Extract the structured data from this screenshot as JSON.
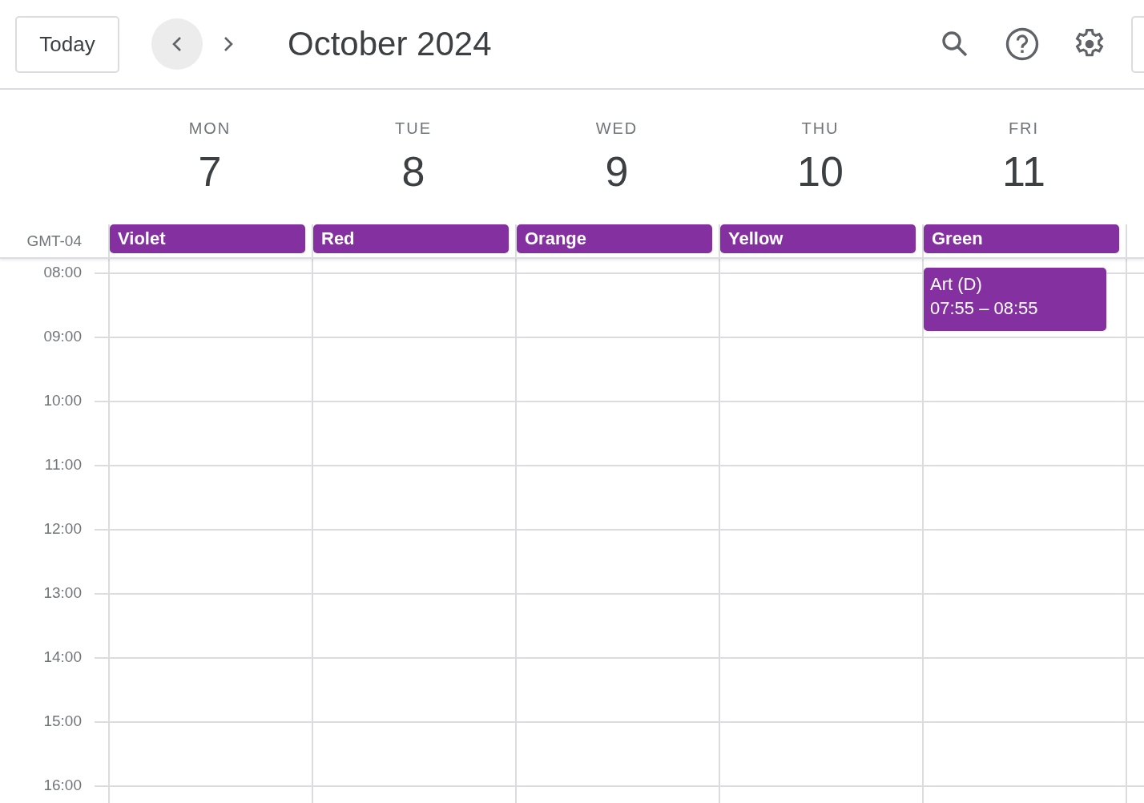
{
  "toolbar": {
    "today_button": "Today",
    "title": "October 2024"
  },
  "timezone": "GMT-04",
  "days": [
    {
      "weekday": "MON",
      "date": "7",
      "all_day": "Violet"
    },
    {
      "weekday": "TUE",
      "date": "8",
      "all_day": "Red"
    },
    {
      "weekday": "WED",
      "date": "9",
      "all_day": "Orange"
    },
    {
      "weekday": "THU",
      "date": "10",
      "all_day": "Yellow"
    },
    {
      "weekday": "FRI",
      "date": "11",
      "all_day": "Green",
      "events": [
        {
          "title": "Art (D)",
          "time": "07:55 – 08:55"
        }
      ]
    }
  ],
  "hours": [
    "08:00",
    "09:00",
    "10:00",
    "11:00",
    "12:00",
    "13:00",
    "14:00",
    "15:00",
    "16:00"
  ]
}
